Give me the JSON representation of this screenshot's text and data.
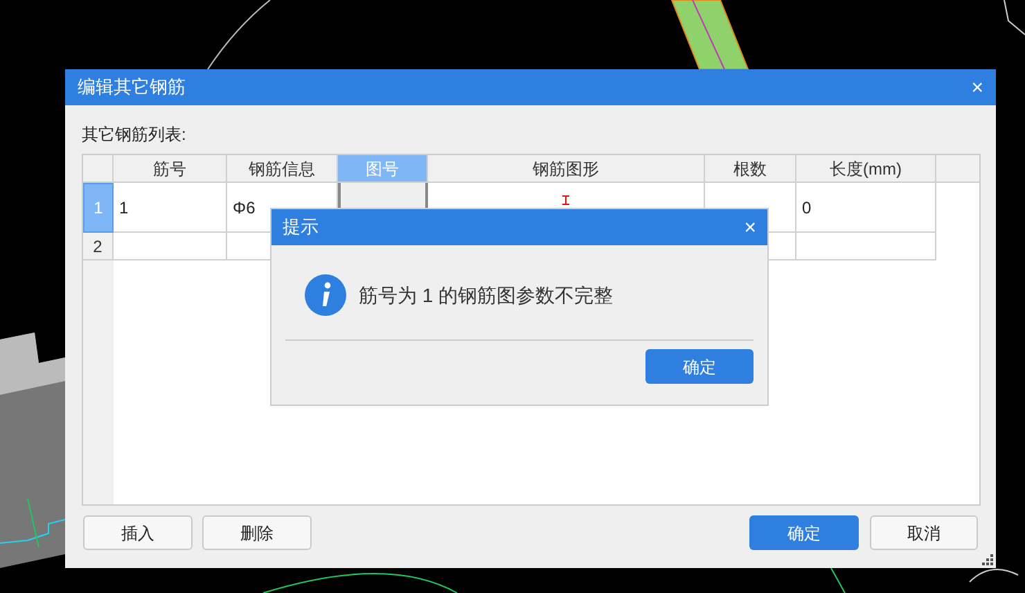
{
  "dialog": {
    "title": "编辑其它钢筋",
    "close": "×",
    "list_label": "其它钢筋列表:",
    "columns": [
      {
        "label": "筋号",
        "selected": false
      },
      {
        "label": "钢筋信息",
        "selected": false
      },
      {
        "label": "图号",
        "selected": true
      },
      {
        "label": "钢筋图形",
        "selected": false
      },
      {
        "label": "根数",
        "selected": false
      },
      {
        "label": "长度(mm)",
        "selected": false
      }
    ],
    "rows": [
      {
        "index": "1",
        "selected": true,
        "cells": {
          "bar_no": "1",
          "info": "Φ6",
          "length": "0"
        },
        "shape": true
      },
      {
        "index": "2",
        "selected": false
      }
    ],
    "buttons_left": [
      "插入",
      "删除"
    ],
    "ok": "确定",
    "cancel": "取消"
  },
  "message_box": {
    "title": "提示",
    "close": "×",
    "message": "筋号为 1 的钢筋图参数不完整",
    "ok": "确定"
  }
}
